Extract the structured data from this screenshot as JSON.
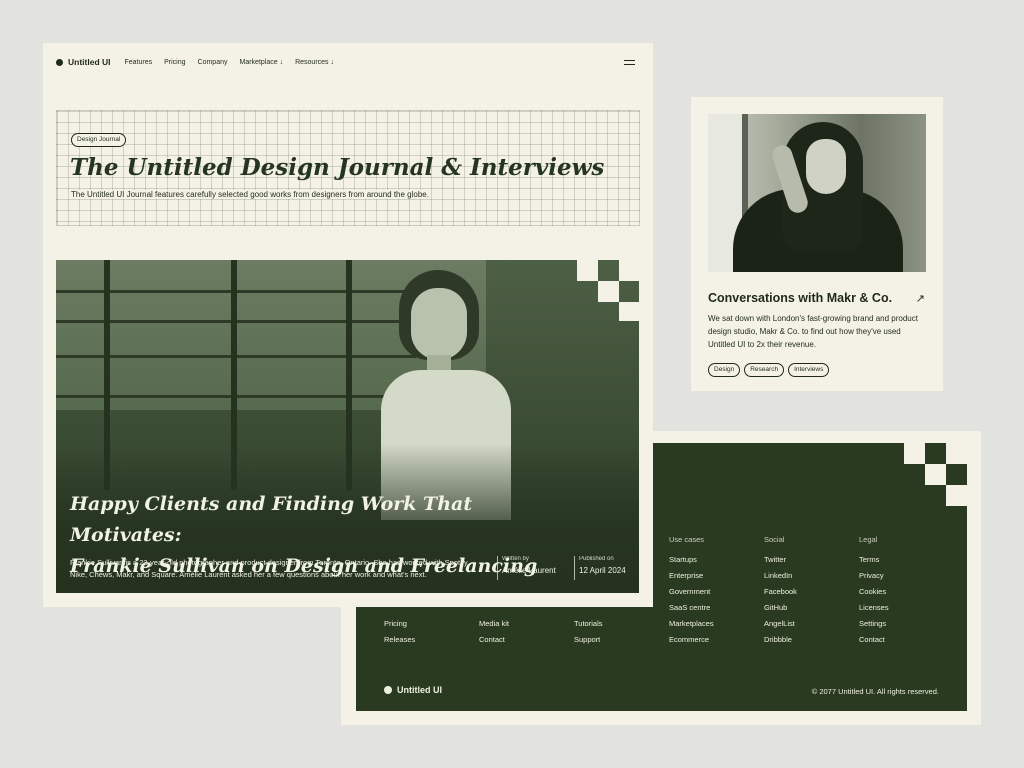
{
  "main": {
    "nav": {
      "brand": "Untitled UI",
      "links": [
        "Features",
        "Pricing",
        "Company",
        "Marketplace ↓",
        "Resources ↓"
      ]
    },
    "hero": {
      "pill": "Design Journal",
      "title": "The Untitled Design Journal & Interviews",
      "subtitle": "The Untitled UI Journal features carefully selected good works from designers from around the globe."
    },
    "feature": {
      "title_line1": "Happy Clients and Finding Work That Motivates:",
      "title_line2": "Frankie Sullivan on Design and Freelancing",
      "description": "Frankie Sullivan is a 23-year-old photographer and product designer from Toronto, Ontario. She has worked with Spotify, Nike, Chews, Makr, and Square. Amélie Laurent asked her a few questions about her work and what's next.",
      "written_by_label": "Written by",
      "author": "Amélie Laurent",
      "published_label": "Published on",
      "date": "12 April 2024"
    }
  },
  "interview": {
    "title": "Conversations with Makr & Co.",
    "arrow_icon": "arrow-up-right-icon",
    "description": "We sat down with London's fast-growing brand and product design studio, Makr & Co. to find out how they've used Untitled UI to 2x their revenue.",
    "tags": [
      "Design",
      "Research",
      "Interviews"
    ]
  },
  "footer": {
    "columns": [
      {
        "title": "",
        "links": [
          "Pricing",
          "Releases"
        ]
      },
      {
        "title": "",
        "links": [
          "Media kit",
          "Contact"
        ]
      },
      {
        "title": "",
        "links": [
          "Tutorials",
          "Support"
        ]
      },
      {
        "title": "Use cases",
        "links": [
          "Startups",
          "Enterprise",
          "Government",
          "SaaS centre",
          "Marketplaces",
          "Ecommerce"
        ]
      },
      {
        "title": "Social",
        "links": [
          "Twitter",
          "LinkedIn",
          "Facebook",
          "GitHub",
          "AngelList",
          "Dribbble"
        ]
      },
      {
        "title": "Legal",
        "links": [
          "Terms",
          "Privacy",
          "Cookies",
          "Licenses",
          "Settings",
          "Contact"
        ]
      }
    ],
    "brand": "Untitled UI",
    "copyright": "© 2077 Untitled UI. All rights reserved."
  },
  "colors": {
    "background": "#e2e2df",
    "card": "#f4f2e6",
    "forest": "#2a3a20",
    "ink": "#1f2a1b"
  }
}
